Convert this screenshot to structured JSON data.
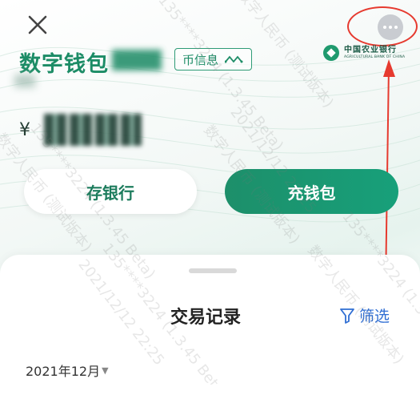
{
  "header": {
    "title": "数字钱包",
    "coin_info_label": "币信息",
    "bank_name": "中国农业银行",
    "bank_name_en": "AGRICULTURAL BANK OF CHINA"
  },
  "balance": {
    "currency_symbol": "¥"
  },
  "actions": {
    "deposit_label": "存银行",
    "topup_label": "充钱包"
  },
  "transactions": {
    "title": "交易记录",
    "filter_label": "筛选",
    "month_label": "2021年12月"
  },
  "watermark": {
    "line1": "数字人民币 (测试版本)",
    "line2": "135****3224 (1.3.45 Beta)",
    "line3": "2021/12/12 22:25"
  },
  "colors": {
    "brand_green": "#1d8f6a",
    "link_blue": "#2f6ed3",
    "annotation_red": "#e63a2f"
  }
}
